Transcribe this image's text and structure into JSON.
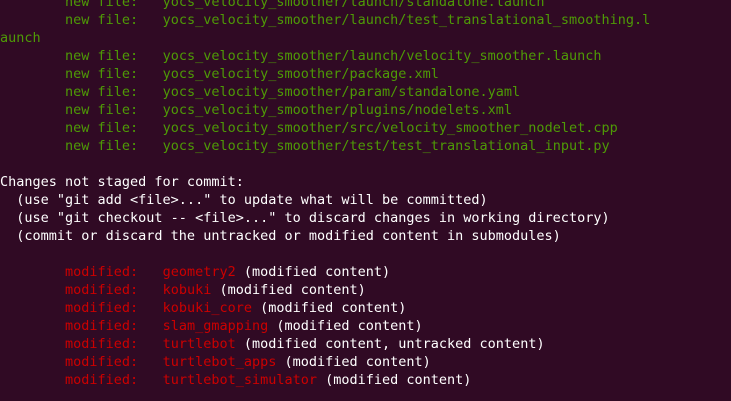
{
  "terminal": {
    "colors": {
      "background": "#300a24",
      "foreground": "#ffffff",
      "staged": "#4e9a06",
      "modified": "#cc0000"
    },
    "staged_files": [
      {
        "label": "        new file:   ",
        "path": "yocs_velocity_smoother/launch/standalone.launch"
      },
      {
        "label": "        new file:   ",
        "path": "yocs_velocity_smoother/launch/test_translational_smoothing.l"
      },
      {
        "label": "",
        "path": "aunch"
      },
      {
        "label": "        new file:   ",
        "path": "yocs_velocity_smoother/launch/velocity_smoother.launch"
      },
      {
        "label": "        new file:   ",
        "path": "yocs_velocity_smoother/package.xml"
      },
      {
        "label": "        new file:   ",
        "path": "yocs_velocity_smoother/param/standalone.yaml"
      },
      {
        "label": "        new file:   ",
        "path": "yocs_velocity_smoother/plugins/nodelets.xml"
      },
      {
        "label": "        new file:   ",
        "path": "yocs_velocity_smoother/src/velocity_smoother_nodelet.cpp"
      },
      {
        "label": "        new file:   ",
        "path": "yocs_velocity_smoother/test/test_translational_input.py"
      }
    ],
    "unstaged_header": "Changes not staged for commit:",
    "hints": [
      "  (use \"git add <file>...\" to update what will be committed)",
      "  (use \"git checkout -- <file>...\" to discard changes in working directory)",
      "  (commit or discard the untracked or modified content in submodules)"
    ],
    "modified_files": [
      {
        "label": "        modified:   ",
        "path": "geometry2",
        "note": " (modified content)"
      },
      {
        "label": "        modified:   ",
        "path": "kobuki",
        "note": " (modified content)"
      },
      {
        "label": "        modified:   ",
        "path": "kobuki_core",
        "note": " (modified content)"
      },
      {
        "label": "        modified:   ",
        "path": "slam_gmapping",
        "note": " (modified content)"
      },
      {
        "label": "        modified:   ",
        "path": "turtlebot",
        "note": " (modified content, untracked content)"
      },
      {
        "label": "        modified:   ",
        "path": "turtlebot_apps",
        "note": " (modified content)"
      },
      {
        "label": "        modified:   ",
        "path": "turtlebot_simulator",
        "note": " (modified content)"
      }
    ]
  }
}
